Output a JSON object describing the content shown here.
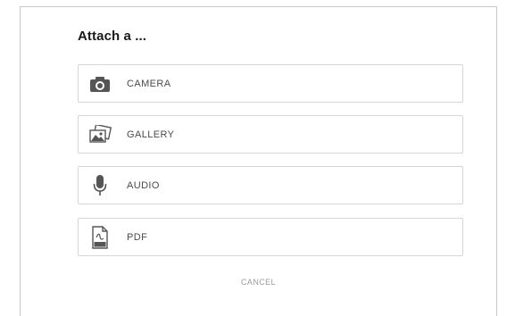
{
  "dialog": {
    "title": "Attach a ...",
    "options": [
      {
        "label": "CAMERA",
        "icon": "camera-icon"
      },
      {
        "label": "GALLERY",
        "icon": "gallery-icon"
      },
      {
        "label": "AUDIO",
        "icon": "microphone-icon"
      },
      {
        "label": "PDF",
        "icon": "pdf-file-icon"
      }
    ],
    "cancel_label": "CANCEL"
  },
  "colors": {
    "icon": "#555555",
    "border": "#d6d6d6",
    "title": "#1a1a1a"
  }
}
